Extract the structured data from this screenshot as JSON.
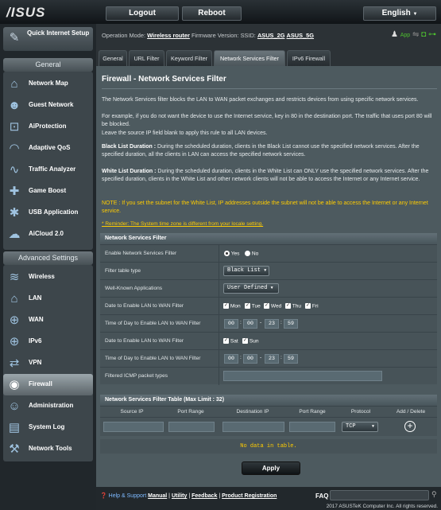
{
  "header": {
    "logo": "/ISUS",
    "logout": "Logout",
    "reboot": "Reboot",
    "language": "English"
  },
  "sidebar": {
    "quick_setup": "Quick Internet Setup",
    "general_title": "General",
    "general_items": [
      "Network Map",
      "Guest Network",
      "AiProtection",
      "Adaptive QoS",
      "Traffic Analyzer",
      "Game Boost",
      "USB Application",
      "AiCloud 2.0"
    ],
    "advanced_title": "Advanced Settings",
    "advanced_items": [
      "Wireless",
      "LAN",
      "WAN",
      "IPv6",
      "VPN",
      "Firewall",
      "Administration",
      "System Log",
      "Network Tools"
    ],
    "active": "Firewall"
  },
  "status": {
    "mode_label": "Operation Mode:",
    "mode": "Wireless router",
    "fw_label": "Firmware Version:",
    "ssid_label": "SSID:",
    "ssid1": "ASUS_2G",
    "ssid2": "ASUS_5G",
    "app_label": "App"
  },
  "tabs": [
    "General",
    "URL Filter",
    "Keyword Filter",
    "Network Services Filter",
    "IPv6 Firewall"
  ],
  "selected_tab": "Network Services Filter",
  "page": {
    "title": "Firewall - Network Services Filter",
    "desc1": "The Network Services filter blocks the LAN to WAN packet exchanges and restricts devices from using specific network services.",
    "desc2": "For example, if you do not want the device to use the Internet service, key in 80 in the destination port. The traffic that uses port 80 will be blocked.",
    "desc3": "Leave the source IP field blank to apply this rule to all LAN devices.",
    "bl_label": "Black List Duration :",
    "bl_text": "During the scheduled duration, clients in the Black List cannot use the specified network services. After the specified duration, all the clients in LAN can access the specified network services.",
    "wl_label": "White List Duration :",
    "wl_text": "During the scheduled duration, clients in the White List can ONLY use the specified network services. After the specified duration, clients in the White List and other network clients will not be able to access the Internet or any Internet service.",
    "note": "NOTE : If you set the subnet for the White List, IP addresses outside the subnet will not be able to access the Internet or any Internet service.",
    "reminder": "* Reminder: The System time zone is different from your locale setting."
  },
  "filter": {
    "header": "Network Services Filter",
    "enable_label": "Enable Network Services Filter",
    "yes": "Yes",
    "no": "No",
    "enabled": true,
    "type_label": "Filter table type",
    "type_value": "Black List",
    "apps_label": "Well-Known Applications",
    "apps_value": "User Defined",
    "date1_label": "Date to Enable LAN to WAN Filter",
    "days1": [
      "Mon",
      "Tue",
      "Wed",
      "Thu",
      "Fri"
    ],
    "time1_label": "Time of Day to Enable LAN to WAN Filter",
    "time1": [
      "00",
      "00",
      "23",
      "59"
    ],
    "date2_label": "Date to Enable LAN to WAN Filter",
    "days2": [
      "Sat",
      "Sun"
    ],
    "time2_label": "Time of Day to Enable LAN to WAN Filter",
    "time2": [
      "00",
      "00",
      "23",
      "59"
    ],
    "icmp_label": "Filtered ICMP packet types"
  },
  "rules": {
    "header": "Network Services Filter Table (Max Limit : 32)",
    "columns": [
      "Source IP",
      "Port Range",
      "Destination IP",
      "Port Range",
      "Protocol",
      "Add / Delete"
    ],
    "protocol": "TCP",
    "no_data": "No data in table."
  },
  "apply": "Apply",
  "footer": {
    "help": "Help & Support",
    "manual": "Manual",
    "utility": "Utility",
    "feedback": "Feedback",
    "product_reg": "Product Registration",
    "faq": "FAQ",
    "copyright": "2017 ASUSTeK Computer Inc. All rights reserved."
  }
}
